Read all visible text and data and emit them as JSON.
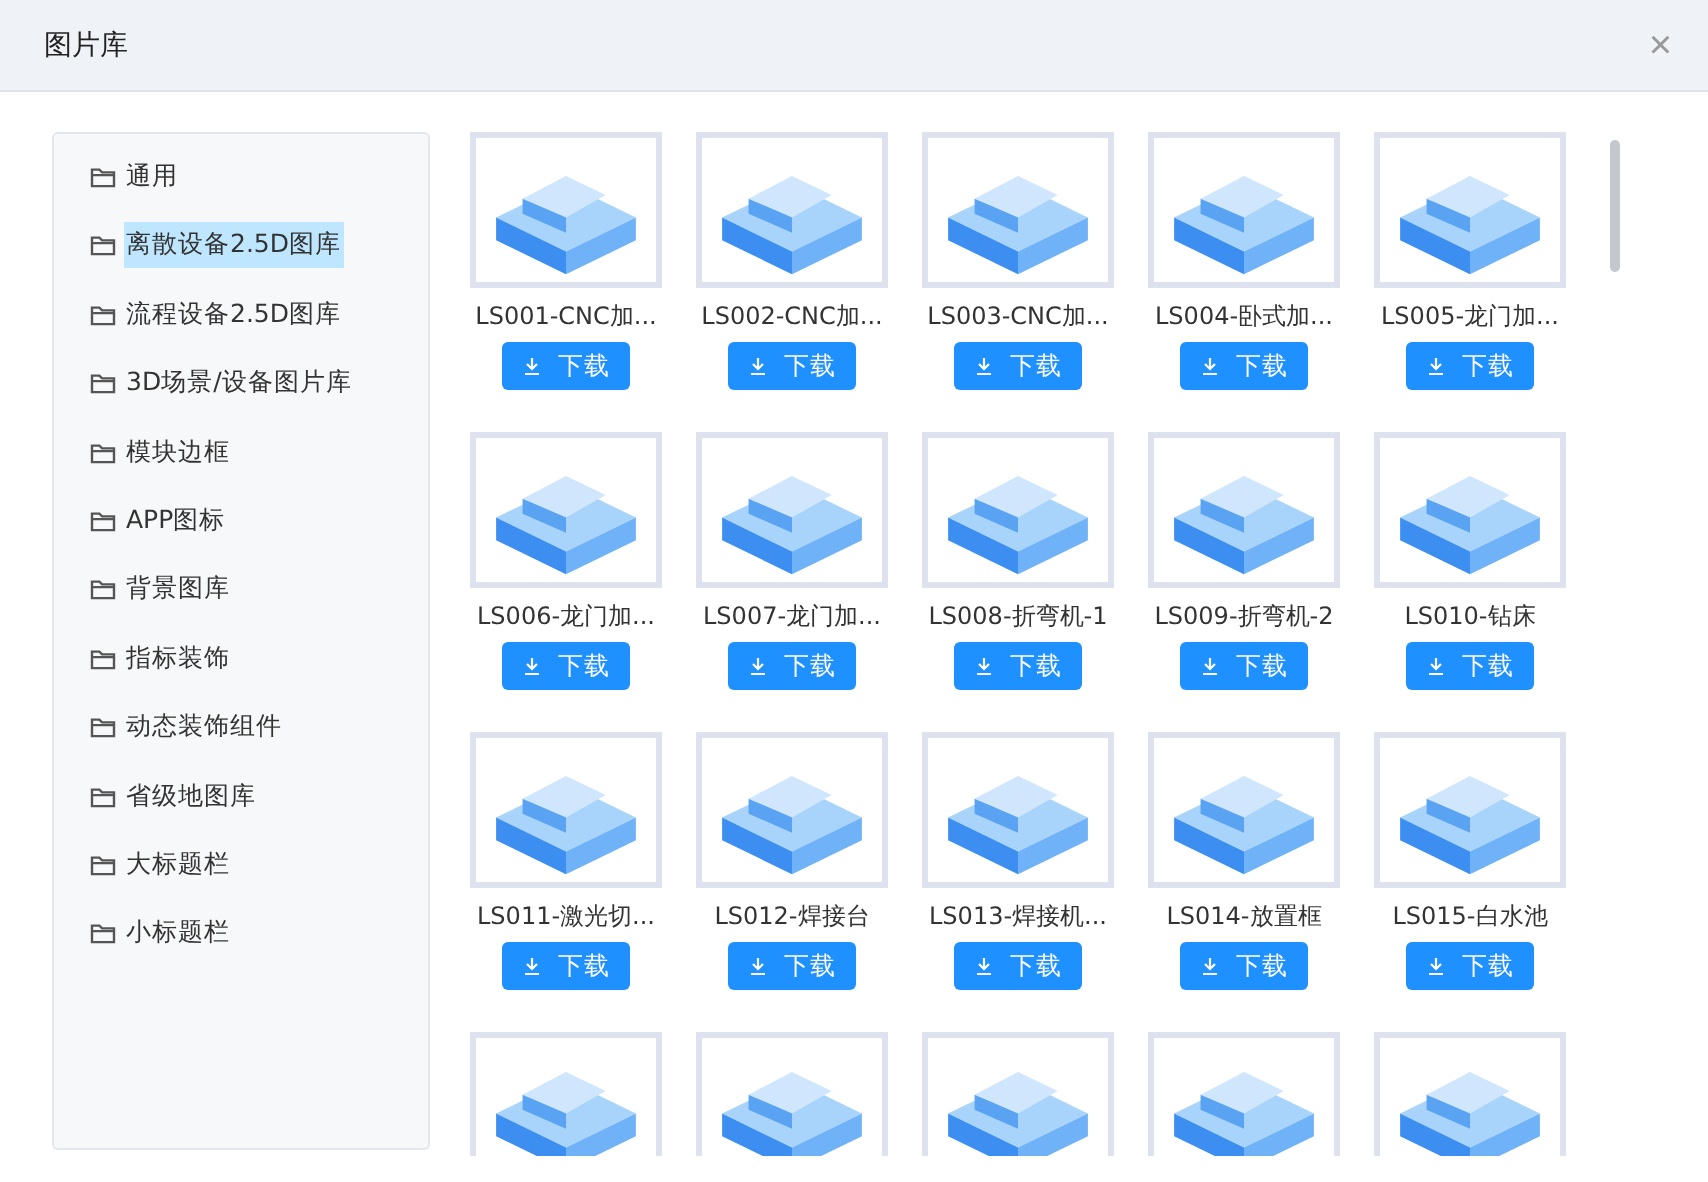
{
  "window": {
    "title": "图片库",
    "close": "×"
  },
  "sidebar": {
    "items": [
      {
        "label": "通用",
        "selected": false
      },
      {
        "label": "离散设备2.5D图库",
        "selected": true
      },
      {
        "label": "流程设备2.5D图库",
        "selected": false
      },
      {
        "label": "3D场景/设备图片库",
        "selected": false
      },
      {
        "label": "模块边框",
        "selected": false
      },
      {
        "label": "APP图标",
        "selected": false
      },
      {
        "label": "背景图库",
        "selected": false
      },
      {
        "label": "指标装饰",
        "selected": false
      },
      {
        "label": "动态装饰组件",
        "selected": false
      },
      {
        "label": "省级地图库",
        "selected": false
      },
      {
        "label": "大标题栏",
        "selected": false
      },
      {
        "label": "小标题栏",
        "selected": false
      }
    ]
  },
  "gallery": {
    "items": [
      {
        "name": "LS001-CNC加...",
        "button": "下载"
      },
      {
        "name": "LS002-CNC加...",
        "button": "下载"
      },
      {
        "name": "LS003-CNC加...",
        "button": "下载"
      },
      {
        "name": "LS004-卧式加...",
        "button": "下载"
      },
      {
        "name": "LS005-龙门加...",
        "button": "下载"
      },
      {
        "name": "LS006-龙门加...",
        "button": "下载"
      },
      {
        "name": "LS007-龙门加...",
        "button": "下载"
      },
      {
        "name": "LS008-折弯机-1",
        "button": "下载"
      },
      {
        "name": "LS009-折弯机-2",
        "button": "下载"
      },
      {
        "name": "LS010-钻床",
        "button": "下载"
      },
      {
        "name": "LS011-激光切...",
        "button": "下载"
      },
      {
        "name": "LS012-焊接台",
        "button": "下载"
      },
      {
        "name": "LS013-焊接机...",
        "button": "下载"
      },
      {
        "name": "LS014-放置框",
        "button": "下载"
      },
      {
        "name": "LS015-白水池",
        "button": "下载"
      },
      {
        "kind": "cut_off"
      },
      {
        "kind": "cut_off"
      },
      {
        "kind": "cut_off"
      },
      {
        "kind": "cut_off"
      },
      {
        "kind": "cut_off"
      }
    ]
  }
}
